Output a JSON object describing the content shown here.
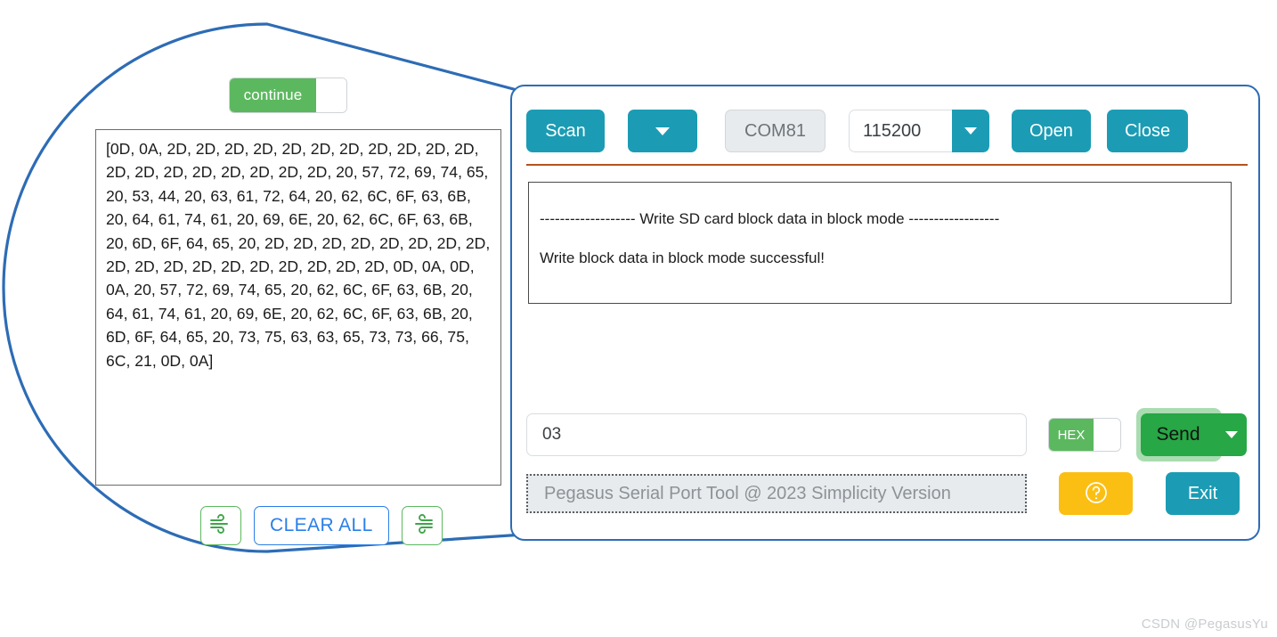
{
  "magnifier": {
    "border_color": "#2d6cb5",
    "toggle": {
      "label": "continue",
      "state": "on"
    },
    "receive_textarea": {
      "value": "[0D, 0A, 2D, 2D, 2D, 2D, 2D, 2D, 2D, 2D, 2D, 2D, 2D, 2D, 2D, 2D, 2D, 2D, 2D, 2D, 2D, 20, 57, 72, 69, 74, 65, 20, 53, 44, 20, 63, 61, 72, 64, 20, 62, 6C, 6F, 63, 6B, 20, 64, 61, 74, 61, 20, 69, 6E, 20, 62, 6C, 6F, 63, 6B, 20, 6D, 6F, 64, 65, 20, 2D, 2D, 2D, 2D, 2D, 2D, 2D, 2D, 2D, 2D, 2D, 2D, 2D, 2D, 2D, 2D, 2D, 2D, 0D, 0A, 0D, 0A, 20, 57, 72, 69, 74, 65, 20, 62, 6C, 6F, 63, 6B, 20, 64, 61, 74, 61, 20, 69, 6E, 20, 62, 6C, 6F, 63, 6B, 20, 6D, 6F, 64, 65, 20, 73, 75, 63, 63, 65, 73, 73, 66, 75, 6C, 21, 0D, 0A]"
    },
    "buttons": {
      "save_left_icon": "wind-icon",
      "clear_all_label": "CLEAR ALL",
      "save_right_icon": "wind-icon"
    }
  },
  "app": {
    "toolbar": {
      "scan_label": "Scan",
      "scan_dropdown_icon": "chevron-down-icon",
      "port_value": "COM81",
      "baud_value": "115200",
      "baud_dropdown_icon": "chevron-down-icon",
      "open_label": "Open",
      "close_label": "Close"
    },
    "divider_color": "#b5521c",
    "terminal": {
      "lines": [
        "------------------- Write SD card block data in block mode ------------------",
        "",
        "Write block data in block mode successful!"
      ]
    },
    "send": {
      "input_value": "03",
      "input_placeholder": "",
      "hex_label": "HEX",
      "hex_state": "on",
      "send_label": "Send",
      "send_dropdown_icon": "chevron-down-icon"
    },
    "status": {
      "text": "Pegasus Serial Port Tool @ 2023 Simplicity Version",
      "help_icon": "question-circle-icon",
      "exit_label": "Exit"
    },
    "colors": {
      "teal": "#1b9cb4",
      "green": "#27a745",
      "toggle_green": "#5cb85f",
      "yellow": "#fbbf14",
      "window_border": "#2d6cb5"
    }
  },
  "watermark": {
    "text": "CSDN @PegasusYu"
  }
}
